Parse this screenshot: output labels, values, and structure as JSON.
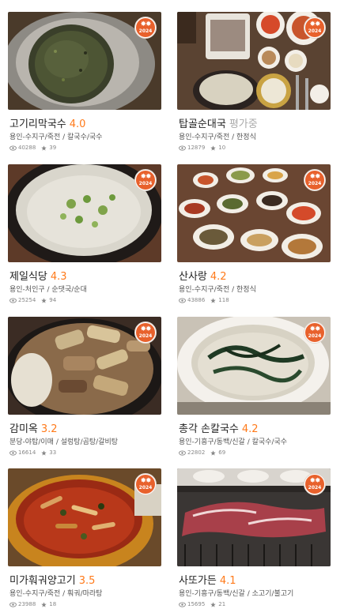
{
  "badge": {
    "year": "2024",
    "leaf": "✸✸"
  },
  "cards": [
    {
      "name": "고기리막국수",
      "rating": "4.0",
      "location": "용인-수지구/죽전",
      "category": "칼국수/국수",
      "views": "40288",
      "reviews": "39",
      "photo_icon": "noodle-bowl"
    },
    {
      "name": "탑골순대국",
      "rating": "평가중",
      "location": "용인-수지구/죽전",
      "category": "한정식",
      "views": "12879",
      "reviews": "10",
      "photo_icon": "soup-table"
    },
    {
      "name": "제일식당",
      "rating": "4.3",
      "location": "용인-처인구",
      "category": "순댓국/순대",
      "views": "25254",
      "reviews": "94",
      "photo_icon": "soup-bowl"
    },
    {
      "name": "산사랑",
      "rating": "4.2",
      "location": "용인-수지구/죽전",
      "category": "한정식",
      "views": "43886",
      "reviews": "118",
      "photo_icon": "banchan-table"
    },
    {
      "name": "감미옥",
      "rating": "3.2",
      "location": "분당-야탑/이매",
      "category": "설렁탕/곰탕/갈비탕",
      "views": "16614",
      "reviews": "33",
      "photo_icon": "tripe-pot"
    },
    {
      "name": "총각 손칼국수",
      "rating": "4.2",
      "location": "용인-기흥구/동백/신갈",
      "category": "칼국수/국수",
      "views": "22802",
      "reviews": "69",
      "photo_icon": "noodle-soup"
    },
    {
      "name": "미가훠궈양고기",
      "rating": "3.5",
      "location": "용인-수지구/죽전",
      "category": "훠궈/마라탕",
      "views": "23988",
      "reviews": "18",
      "photo_icon": "spicy-hotpot"
    },
    {
      "name": "사또가든",
      "rating": "4.1",
      "location": "용인-기흥구/동백/신갈",
      "category": "소고기/불고기",
      "views": "15695",
      "reviews": "21",
      "photo_icon": "grill-beef"
    }
  ]
}
